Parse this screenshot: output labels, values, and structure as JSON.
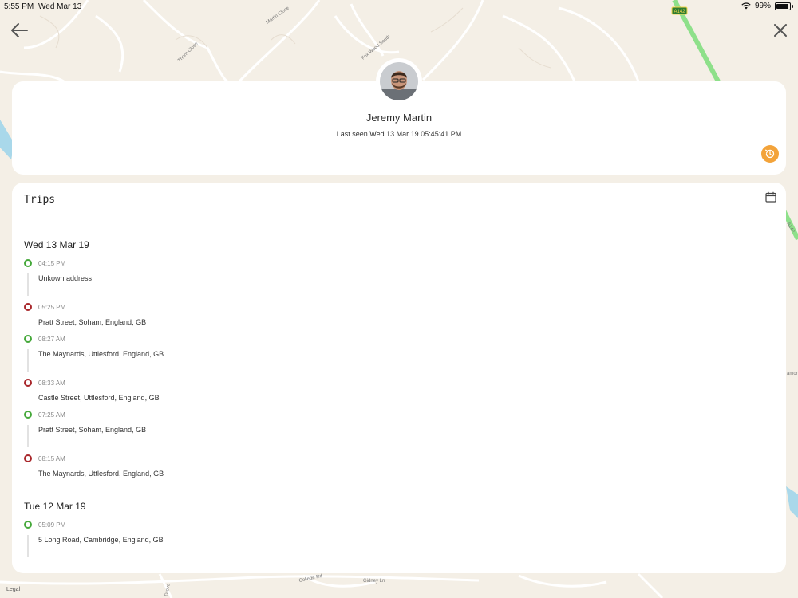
{
  "status_bar": {
    "time": "5:55 PM",
    "date": "Wed Mar 13",
    "battery": "99%"
  },
  "map": {
    "street_labels": [
      "Martin Close",
      "Thorn Close",
      "Fox Wood South",
      "College Rd",
      "Gidney Ln",
      "Drove",
      "A142",
      "Sp",
      "amon"
    ],
    "road_badge": "A142",
    "legal": "Legal"
  },
  "profile": {
    "name": "Jeremy Martin",
    "last_seen": "Last seen Wed 13 Mar 19 05:45:41 PM"
  },
  "trips": {
    "title": "Trips",
    "days": [
      {
        "heading": "Wed 13 Mar 19",
        "stops": [
          {
            "type": "start",
            "time": "04:15 PM",
            "address": "Unkown address"
          },
          {
            "type": "end",
            "time": "05:25 PM",
            "address": "Pratt Street, Soham, England, GB"
          },
          {
            "type": "start",
            "time": "08:27 AM",
            "address": "The Maynards, Uttlesford, England, GB"
          },
          {
            "type": "end",
            "time": "08:33 AM",
            "address": "Castle Street, Uttlesford, England, GB"
          },
          {
            "type": "start",
            "time": "07:25 AM",
            "address": "Pratt Street, Soham, England, GB"
          },
          {
            "type": "end",
            "time": "08:15 AM",
            "address": "The Maynards, Uttlesford, England, GB"
          }
        ]
      },
      {
        "heading": "Tue 12 Mar 19",
        "stops": [
          {
            "type": "start",
            "time": "05:09 PM",
            "address": "5  Long Road, Cambridge, England, GB"
          }
        ]
      }
    ]
  },
  "icons": {
    "back": "arrow-left-icon",
    "close": "close-icon",
    "history": "history-icon",
    "calendar": "calendar-icon"
  },
  "colors": {
    "accent": "#f3a33a",
    "start_dot": "#45a83a",
    "end_dot": "#a8262a",
    "map_bg": "#f4efe6",
    "water": "#a9d8ea",
    "highway": "#8ee08a"
  }
}
